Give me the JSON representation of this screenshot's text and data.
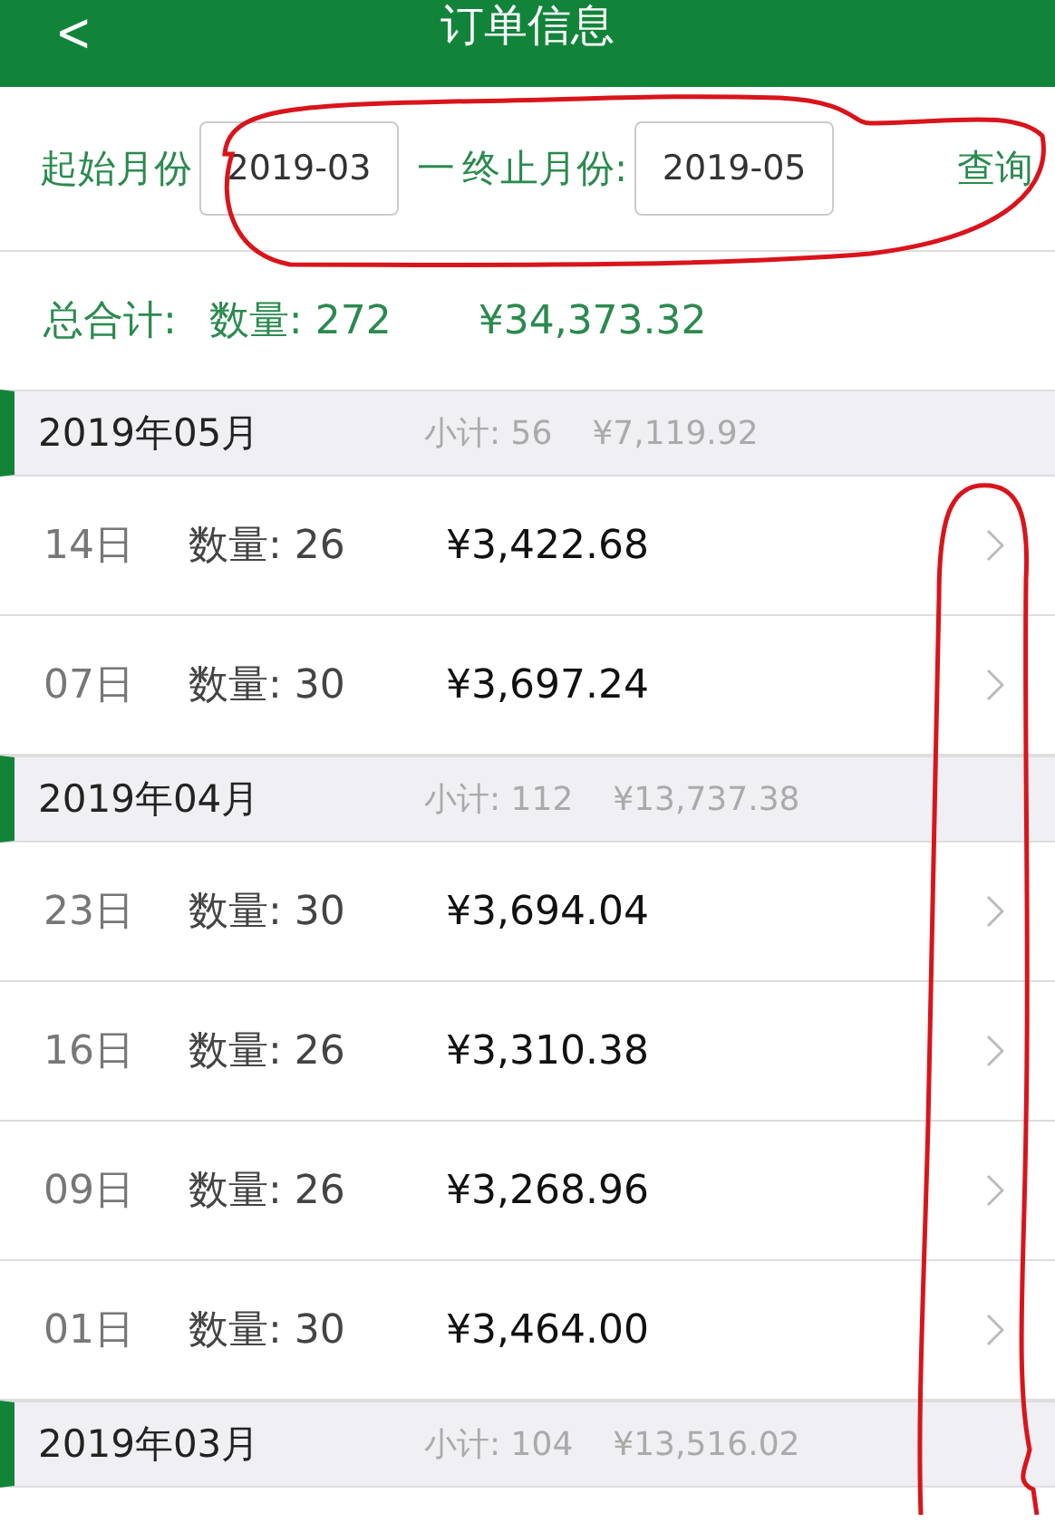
{
  "header": {
    "back": "<",
    "title": "订单信息"
  },
  "filter": {
    "start_label": "起始月份",
    "start_value": "2019-03",
    "separator": "一",
    "end_label": "终止月份:",
    "end_value": "2019-05",
    "query": "查询"
  },
  "total": {
    "label": "总合计:",
    "quantity": "数量: 272",
    "amount": "¥34,373.32"
  },
  "months": [
    {
      "title": "2019年05月",
      "subtotal_count": "小计: 56",
      "subtotal_amount": "¥7,119.92",
      "days": [
        {
          "day": "14日",
          "quantity": "数量: 26",
          "amount": "¥3,422.68"
        },
        {
          "day": "07日",
          "quantity": "数量: 30",
          "amount": "¥3,697.24"
        }
      ]
    },
    {
      "title": "2019年04月",
      "subtotal_count": "小计: 112",
      "subtotal_amount": "¥13,737.38",
      "days": [
        {
          "day": "23日",
          "quantity": "数量: 30",
          "amount": "¥3,694.04"
        },
        {
          "day": "16日",
          "quantity": "数量: 26",
          "amount": "¥3,310.38"
        },
        {
          "day": "09日",
          "quantity": "数量: 26",
          "amount": "¥3,268.96"
        },
        {
          "day": "01日",
          "quantity": "数量: 30",
          "amount": "¥3,464.00"
        }
      ]
    },
    {
      "title": "2019年03月",
      "subtotal_count": "小计: 104",
      "subtotal_amount": "¥13,516.02"
    }
  ]
}
